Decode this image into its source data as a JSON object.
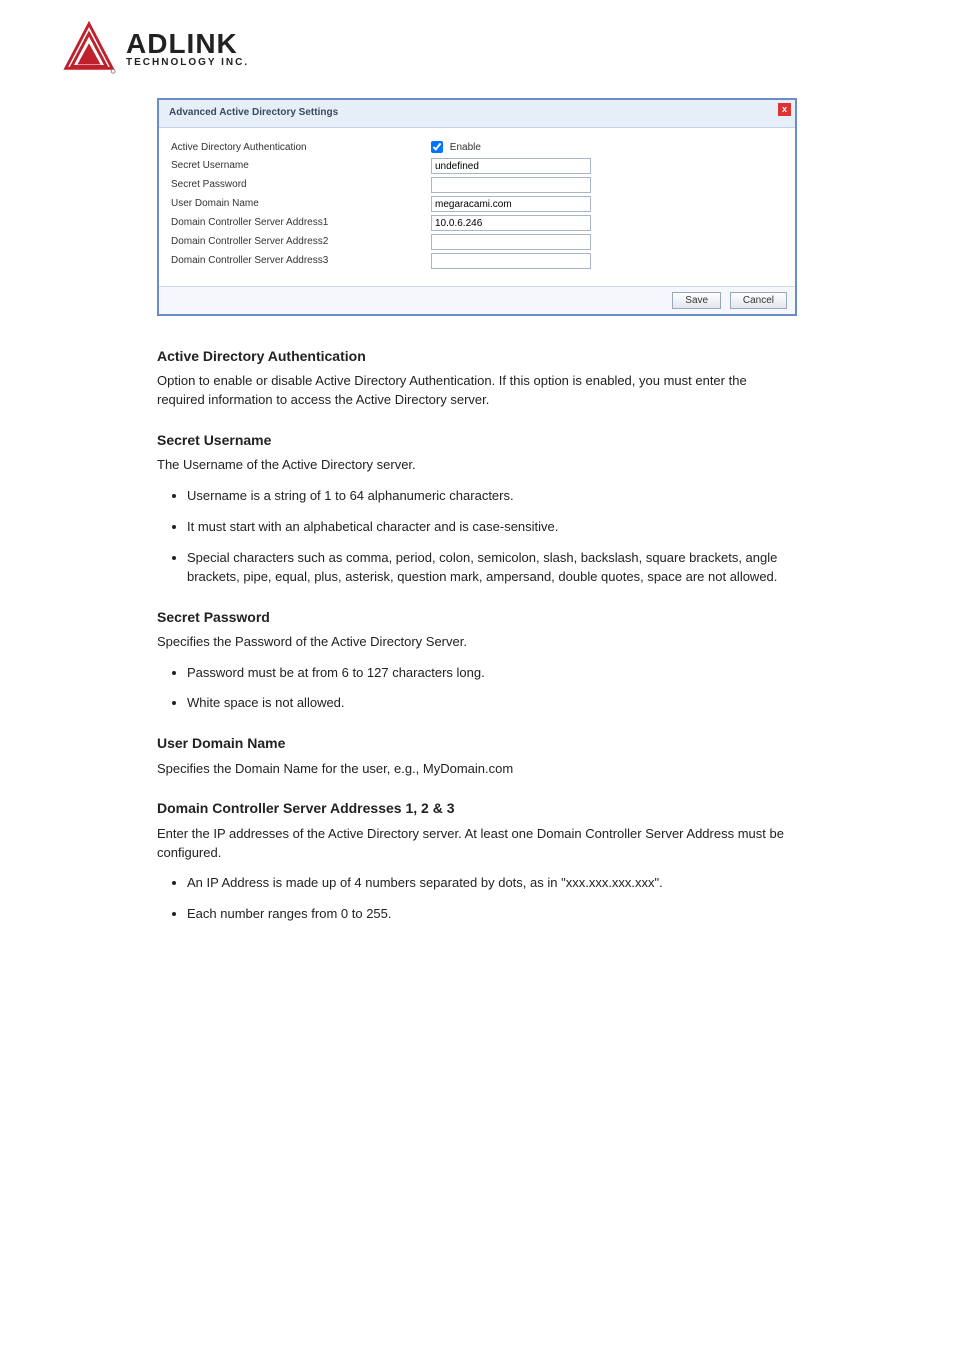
{
  "logo": {
    "brand": "ADLINK",
    "sub": "TECHNOLOGY INC."
  },
  "dialog": {
    "title": "Advanced Active Directory Settings",
    "close": "x",
    "rows": {
      "auth_label": "Active Directory Authentication",
      "enable_label": "Enable",
      "secret_user_label": "Secret Username",
      "secret_user_value": "undefined",
      "secret_pass_label": "Secret Password",
      "secret_pass_value": "",
      "domain_name_label": "User Domain Name",
      "domain_name_value": "megaracami.com",
      "dc1_label": "Domain Controller Server Address1",
      "dc1_value": "10.0.6.246",
      "dc2_label": "Domain Controller Server Address2",
      "dc2_value": "",
      "dc3_label": "Domain Controller Server Address3",
      "dc3_value": ""
    },
    "buttons": {
      "save": "Save",
      "cancel": "Cancel"
    }
  },
  "doc": {
    "ad_auth_h": "Active Directory Authentication",
    "ad_auth_p": "Option to enable or disable Active Directory Authentication. If this option is enabled, you must enter the required information to access the Active Directory server.",
    "secret_user_h": "Secret Username",
    "secret_user_p": "The Username of the Active Directory server.",
    "secret_user_bullets": [
      "Username is a string of 1 to 64 alphanumeric characters.",
      "It must start with an alphabetical character and is case-sensitive.",
      "Special characters such as comma, period, colon, semicolon, slash, backslash, square brackets, angle brackets, pipe, equal, plus, asterisk, question mark, ampersand, double quotes, space are not allowed."
    ],
    "secret_pass_h": "Secret Password",
    "secret_pass_p": "Specifies the Password of the Active Directory Server.",
    "secret_pass_bullets": [
      "Password must be at from 6 to 127 characters long.",
      "White space is not allowed."
    ],
    "domain_name_h": "User Domain Name",
    "domain_name_p": "Specifies the Domain Name for the user, e.g., MyDomain.com",
    "dc_h": "Domain Controller Server Addresses 1, 2 & 3",
    "dc_p": "Enter the IP addresses of the Active Directory server. At least one Domain Controller Server Address must be configured.",
    "dc_bullets": [
      "An IP Address is made up of 4 numbers separated by dots, as in \"xxx.xxx.xxx.xxx\".",
      "Each number ranges from 0 to 255."
    ]
  }
}
